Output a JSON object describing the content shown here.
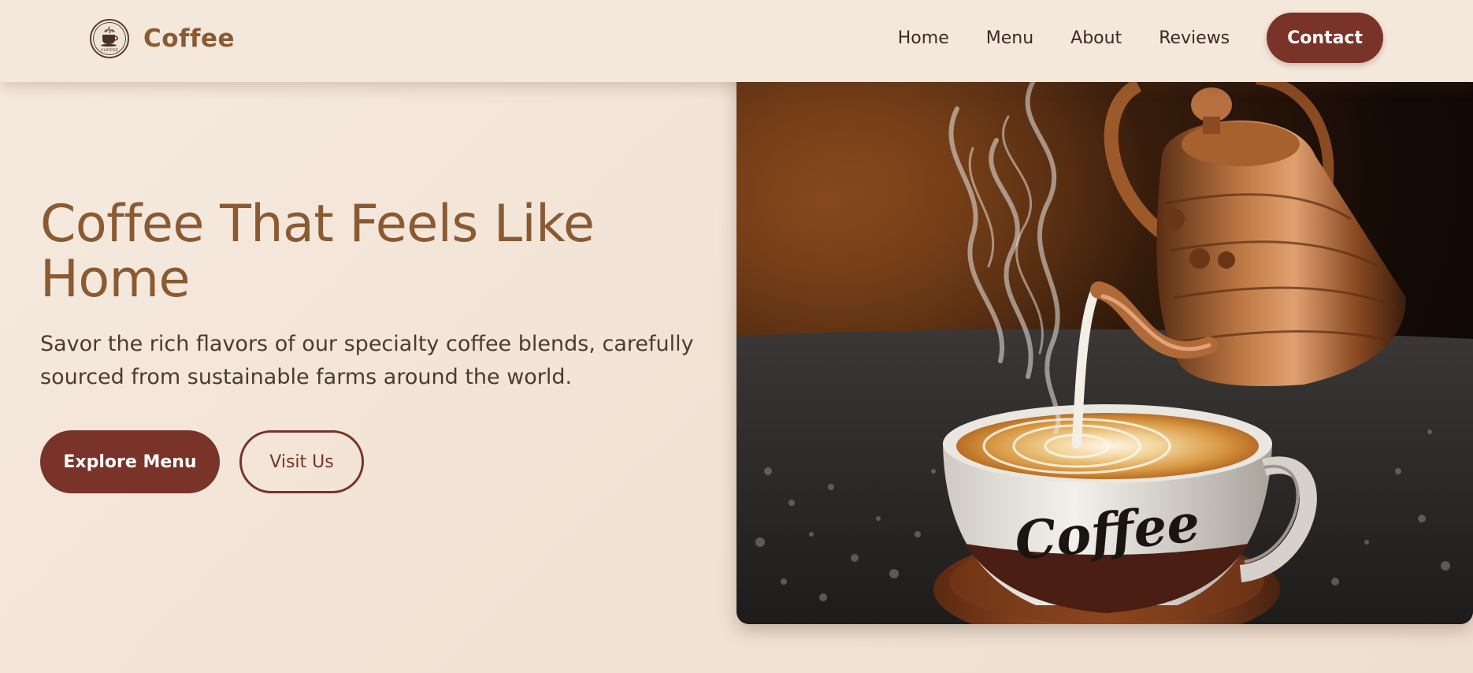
{
  "brand": {
    "name": "Coffee",
    "logo_text": "COFFEE"
  },
  "nav": {
    "links": [
      "Home",
      "Menu",
      "About",
      "Reviews"
    ],
    "contact_label": "Contact"
  },
  "hero": {
    "title": "Coffee That Feels Like Home",
    "subtitle": "Savor the rich flavors of our specialty coffee blends, carefully sourced from sustainable farms around the world.",
    "primary_cta": "Explore Menu",
    "secondary_cta": "Visit Us",
    "image": {
      "description_icon": "coffee-pour-photo",
      "cup_text": "Coffee"
    }
  },
  "colors": {
    "accent": "#7a3328",
    "brand_text": "#8a5a32",
    "background": "#f4e8dc"
  }
}
